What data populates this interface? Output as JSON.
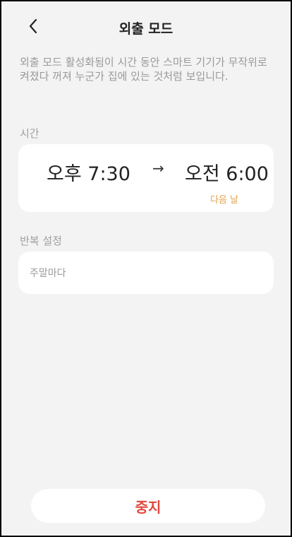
{
  "header": {
    "title": "외출 모드",
    "back_icon": "chevron-left-icon"
  },
  "description": "외출 모드 활성화됨이 시간 동안 스마트 기기가 무작위로 켜졌다 꺼져 누군가 집에 있는 것처럼 보입니다.",
  "time_section": {
    "label": "시간",
    "start": "오후 7:30",
    "arrow": "→",
    "end": "오전 6:00",
    "end_note": "다음 날"
  },
  "repeat_section": {
    "label": "반복 설정",
    "value": "주말마다"
  },
  "stop_button": "중지",
  "colors": {
    "background": "#f3f3f3",
    "accent_orange": "#e3a34a",
    "stop_red": "#e0483c"
  }
}
